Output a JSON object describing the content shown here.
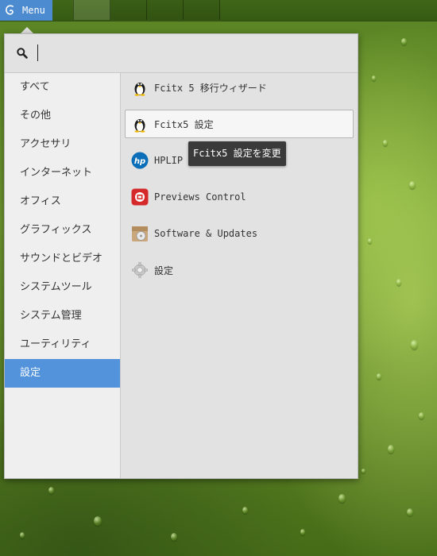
{
  "panel": {
    "menu_label": "Menu"
  },
  "search": {
    "value": "",
    "placeholder": ""
  },
  "categories": [
    {
      "label": "すべて"
    },
    {
      "label": "その他"
    },
    {
      "label": "アクセサリ"
    },
    {
      "label": "インターネット"
    },
    {
      "label": "オフィス"
    },
    {
      "label": "グラフィックス"
    },
    {
      "label": "サウンドとビデオ"
    },
    {
      "label": "システムツール"
    },
    {
      "label": "システム管理"
    },
    {
      "label": "ユーティリティ"
    },
    {
      "label": "設定"
    }
  ],
  "selected_category": "設定",
  "apps": [
    {
      "label": "Fcitx 5 移行ウィザード",
      "icon": "penguin-icon"
    },
    {
      "label": "Fcitx5 設定",
      "icon": "penguin-icon"
    },
    {
      "label": "HPLIP",
      "icon": "hp-logo-icon"
    },
    {
      "label": "Previews Control",
      "icon": "previews-icon"
    },
    {
      "label": "Software & Updates",
      "icon": "software-box-icon"
    },
    {
      "label": "設定",
      "icon": "gear-icon"
    }
  ],
  "tooltip": {
    "text": "Fcitx5 設定を変更"
  },
  "colors": {
    "accent": "#5293dc",
    "panel": "#365a13",
    "tooltip_bg": "#3a3a3a"
  }
}
